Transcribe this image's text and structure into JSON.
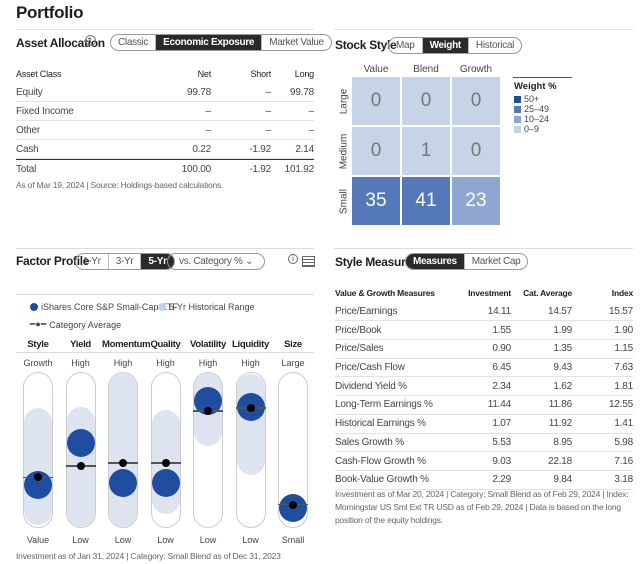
{
  "title": "Portfolio",
  "asset_allocation": {
    "title": "Asset Allocation",
    "tabs": [
      "Classic",
      "Economic Exposure",
      "Market Value"
    ],
    "active_tab": "Economic Exposure",
    "columns": [
      "Asset Class",
      "Net",
      "Short",
      "Long"
    ],
    "rows": [
      [
        "Equity",
        "99.78",
        "–",
        "99.78"
      ],
      [
        "Fixed Income",
        "–",
        "–",
        "–"
      ],
      [
        "Other",
        "–",
        "–",
        "–"
      ],
      [
        "Cash",
        "0.22",
        "-1.92",
        "2.14"
      ]
    ],
    "total": [
      "Total",
      "100.00",
      "-1.92",
      "101.92"
    ],
    "footnote": "As of Mar 19, 2024 | Source: Holdings-based calculations."
  },
  "stock_style": {
    "title": "Stock Style",
    "tabs": [
      "Map",
      "Weight",
      "Historical"
    ],
    "active_tab": "Weight",
    "columns": [
      "Value",
      "Blend",
      "Growth"
    ],
    "rows": [
      "Large",
      "Medium",
      "Small"
    ],
    "values": [
      [
        0,
        0,
        0
      ],
      [
        0,
        1,
        0
      ],
      [
        35,
        41,
        23
      ]
    ],
    "legend_title": "Weight %",
    "legend": [
      {
        "label": "50+",
        "color": "#1f4e9e"
      },
      {
        "label": "25–49",
        "color": "#5579b8"
      },
      {
        "label": "10–24",
        "color": "#8ea6d0"
      },
      {
        "label": "0–9",
        "color": "#c7d4e8"
      }
    ]
  },
  "factor_profile": {
    "title": "Factor Profile",
    "tabs": [
      "1-Yr",
      "3-Yr",
      "5-Yr"
    ],
    "active_tab": "5-Yr",
    "dropdown": "vs. Category %",
    "legend": {
      "investment": "iShares Core S&P Small-Cap ETF",
      "range": "5-Yr Historical Range",
      "category": "Category Average"
    },
    "colors": {
      "investment": "#1f4ea0",
      "range": "#dde4f0",
      "category": "#000000"
    },
    "factors": [
      {
        "name": "Style",
        "top": "Growth",
        "bottom": "Value",
        "investment": 26,
        "category": 31,
        "range": [
          8,
          70
        ]
      },
      {
        "name": "Yield",
        "top": "High",
        "bottom": "Low",
        "investment": 55,
        "category": 39,
        "range": [
          5,
          71
        ]
      },
      {
        "name": "Momentum",
        "top": "High",
        "bottom": "Low",
        "investment": 27,
        "category": 41,
        "range": [
          3,
          95
        ]
      },
      {
        "name": "Quality",
        "top": "High",
        "bottom": "Low",
        "investment": 27,
        "category": 41,
        "range": [
          16,
          69
        ]
      },
      {
        "name": "Volatility",
        "top": "High",
        "bottom": "Low",
        "investment": 84,
        "category": 77,
        "range": [
          63,
          95
        ]
      },
      {
        "name": "Liquidity",
        "top": "High",
        "bottom": "Low",
        "investment": 80,
        "category": 79,
        "range": [
          43,
          94
        ]
      },
      {
        "name": "Size",
        "top": "Large",
        "bottom": "Small",
        "investment": 10,
        "category": 12,
        "range": null
      }
    ],
    "footnote": "Investment as of Jan 31, 2024 | Category: Small Blend as of Dec 31, 2023"
  },
  "style_measures": {
    "title": "Style Measures",
    "tabs": [
      "Measures",
      "Market Cap"
    ],
    "active_tab": "Measures",
    "columns": [
      "Value & Growth Measures",
      "Investment",
      "Cat. Average",
      "Index"
    ],
    "rows": [
      [
        "Price/Earnings",
        "14.11",
        "14.57",
        "15.57"
      ],
      [
        "Price/Book",
        "1.55",
        "1.99",
        "1.90"
      ],
      [
        "Price/Sales",
        "0.90",
        "1.35",
        "1.15"
      ],
      [
        "Price/Cash Flow",
        "6.45",
        "9.43",
        "7.63"
      ],
      [
        "Dividend Yield %",
        "2.34",
        "1.62",
        "1.81"
      ],
      [
        "Long-Term Earnings %",
        "11.44",
        "11.86",
        "12.55"
      ],
      [
        "Historical Earnings %",
        "1.07",
        "11.92",
        "1.41"
      ],
      [
        "Sales Growth %",
        "5.53",
        "8.95",
        "5.98"
      ],
      [
        "Cash-Flow Growth %",
        "9.03",
        "22.18",
        "7.16"
      ],
      [
        "Book-Value Growth %",
        "2.29",
        "9.84",
        "3.18"
      ]
    ],
    "footnote": "Investment as of Mar 20, 2024 | Category: Small Blend as of Feb 29, 2024 | Index: Morningstar US Sml Ext TR USD as of Feb 29, 2024 | Data is based on the long position of the equity holdings."
  }
}
